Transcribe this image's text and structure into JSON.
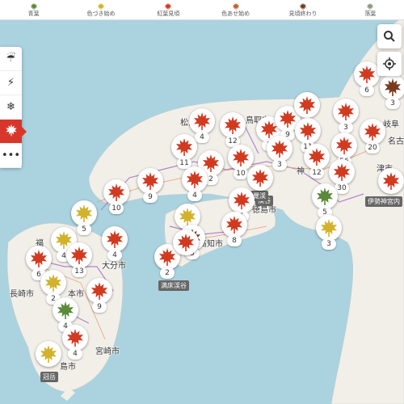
{
  "legend": [
    {
      "label": "青葉",
      "color": "#5a8a3a"
    },
    {
      "label": "色づき始め",
      "color": "#d2b22a"
    },
    {
      "label": "紅葉見頃",
      "color": "#d23a20"
    },
    {
      "label": "色あせ始め",
      "color": "#c06030"
    },
    {
      "label": "見頃終わり",
      "color": "#7a3a20"
    },
    {
      "label": "落葉",
      "color": "#8a9a7a"
    }
  ],
  "toolbar": [
    {
      "name": "weather-tool",
      "icon": "cloud-rain-icon",
      "glyph": "☔"
    },
    {
      "name": "lightning-tool",
      "icon": "lightning-icon",
      "glyph": "⚡"
    },
    {
      "name": "snowflake-tool",
      "icon": "snowflake-icon",
      "glyph": "❄"
    },
    {
      "name": "autumn-leaf-tool",
      "icon": "maple-leaf-icon",
      "glyph": "",
      "active": true
    },
    {
      "name": "more-tool",
      "icon": "more-icon",
      "glyph": "•••"
    }
  ],
  "cities": [
    "鳥取市",
    "松江",
    "岐阜",
    "名古",
    "津市",
    "神",
    "徳島市",
    "大分市",
    "高知市",
    "長崎市",
    "本市",
    "宮崎市",
    "福",
    "島市"
  ],
  "spots": [
    "伊勢神宮内",
    "渓谷",
    "满床渓谷",
    "冠岳",
    "覺渓"
  ],
  "markers": [
    {
      "color": "#d23a20",
      "count": "4"
    },
    {
      "color": "#d23a20",
      "count": "12"
    },
    {
      "color": "#d23a20",
      "count": "7"
    },
    {
      "color": "#d23a20",
      "count": "9"
    },
    {
      "color": "#d23a20",
      "count": ""
    },
    {
      "color": "#d23a20",
      "count": "3"
    },
    {
      "color": "#d23a20",
      "count": "6"
    },
    {
      "color": "#7a3a20",
      "count": "3"
    },
    {
      "color": "#d23a20",
      "count": "20"
    },
    {
      "color": "#d23a20",
      "count": "11"
    },
    {
      "color": "#d23a20",
      "count": "2"
    },
    {
      "color": "#d23a20",
      "count": "10"
    },
    {
      "color": "#d23a20",
      "count": "3"
    },
    {
      "color": "#d23a20",
      "count": "11"
    },
    {
      "color": "#d23a20",
      "count": "56"
    },
    {
      "color": "#d23a20",
      "count": "12"
    },
    {
      "color": "#d23a20",
      "count": ""
    },
    {
      "color": "#d23a20",
      "count": "30"
    },
    {
      "color": "#d23a20",
      "count": "9"
    },
    {
      "color": "#d23a20",
      "count": "4"
    },
    {
      "color": "#d23a20",
      "count": "10"
    },
    {
      "color": "#d23a20",
      "count": "6"
    },
    {
      "color": "#d23a20",
      "count": ""
    },
    {
      "color": "#5a8a3a",
      "count": "5"
    },
    {
      "color": "#d23a20",
      "count": "2"
    },
    {
      "color": "#d2b22a",
      "count": "5"
    },
    {
      "color": "#d2b22a",
      "count": ""
    },
    {
      "color": "#d23a20",
      "count": "8"
    },
    {
      "color": "#d2b22a",
      "count": "3"
    },
    {
      "color": "#7a3a20",
      "count": "5"
    },
    {
      "color": "#d2b22a",
      "count": "4"
    },
    {
      "color": "#d23a20",
      "count": "4"
    },
    {
      "color": "#d23a20",
      "count": "6"
    },
    {
      "color": "#d23a20",
      "count": "13"
    },
    {
      "color": "#d23a20",
      "count": ""
    },
    {
      "color": "#d2b22a",
      "count": "2"
    },
    {
      "color": "#d23a20",
      "count": "9"
    },
    {
      "color": "#5a8a3a",
      "count": "4"
    },
    {
      "color": "#d23a20",
      "count": "4"
    },
    {
      "color": "#d2b22a",
      "count": ""
    }
  ]
}
